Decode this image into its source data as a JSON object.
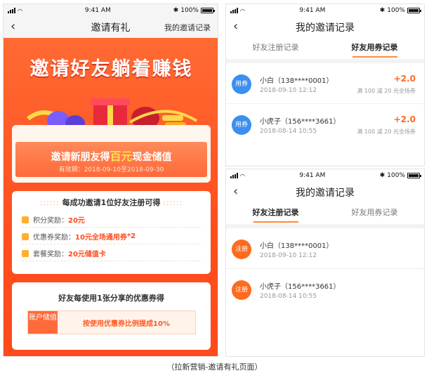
{
  "status_bar": {
    "time": "9:41 AM",
    "battery": "100%",
    "bluetooth": "✱"
  },
  "invite_page": {
    "nav_title": "邀请有礼",
    "nav_right": "我的邀请记录",
    "headline": "邀请好友躺着赚钱",
    "banner_prefix": "邀请新朋友得",
    "banner_highlight": "百元",
    "banner_suffix": "现金储值",
    "validity": "有效期：2018-09-10至2018-09-30",
    "rewards_heading": "每成功邀请1位好友注册可得",
    "rewards": [
      {
        "label": "积分奖励：",
        "value": "20元",
        "extra": ""
      },
      {
        "label": "优惠券奖励：",
        "value": "10元全场通用券",
        "extra": "*2"
      },
      {
        "label": "套餐奖励：",
        "value": "20元储值卡",
        "extra": ""
      }
    ],
    "share_heading": "好友每使用1张分享的优惠券得",
    "share_tag": "账户储值",
    "share_text": "按使用优惠券比例提成10%",
    "decor_dots": "::::::"
  },
  "records_coupon": {
    "nav_title": "我的邀请记录",
    "tabs": [
      "好友注册记录",
      "好友用券记录"
    ],
    "active_tab": 1,
    "records": [
      {
        "badge": "用券",
        "name": "小白（138****0001）",
        "date": "2018-09-10 12:12",
        "amount": "+2.0",
        "desc": "满 100 减 20 元全场券"
      },
      {
        "badge": "用券",
        "name": "小虎子（156****3661）",
        "date": "2018-08-14 10:55",
        "amount": "+2.0",
        "desc": "满 100 减 20 元全场券"
      }
    ]
  },
  "records_register": {
    "nav_title": "我的邀请记录",
    "tabs": [
      "好友注册记录",
      "好友用券记录"
    ],
    "active_tab": 0,
    "records": [
      {
        "badge": "注册",
        "name": "小白（138****0001）",
        "date": "2018-09-10 12:12"
      },
      {
        "badge": "注册",
        "name": "小虎子（156****3661）",
        "date": "2018-08-14 10:55"
      }
    ]
  },
  "caption": "（拉新营销-邀请有礼页面）",
  "colors": {
    "accent": "#ff4e1e",
    "highlight": "#ffe14d",
    "blue_badge": "#3a8ff0",
    "orange_badge": "#ff6a1e"
  }
}
